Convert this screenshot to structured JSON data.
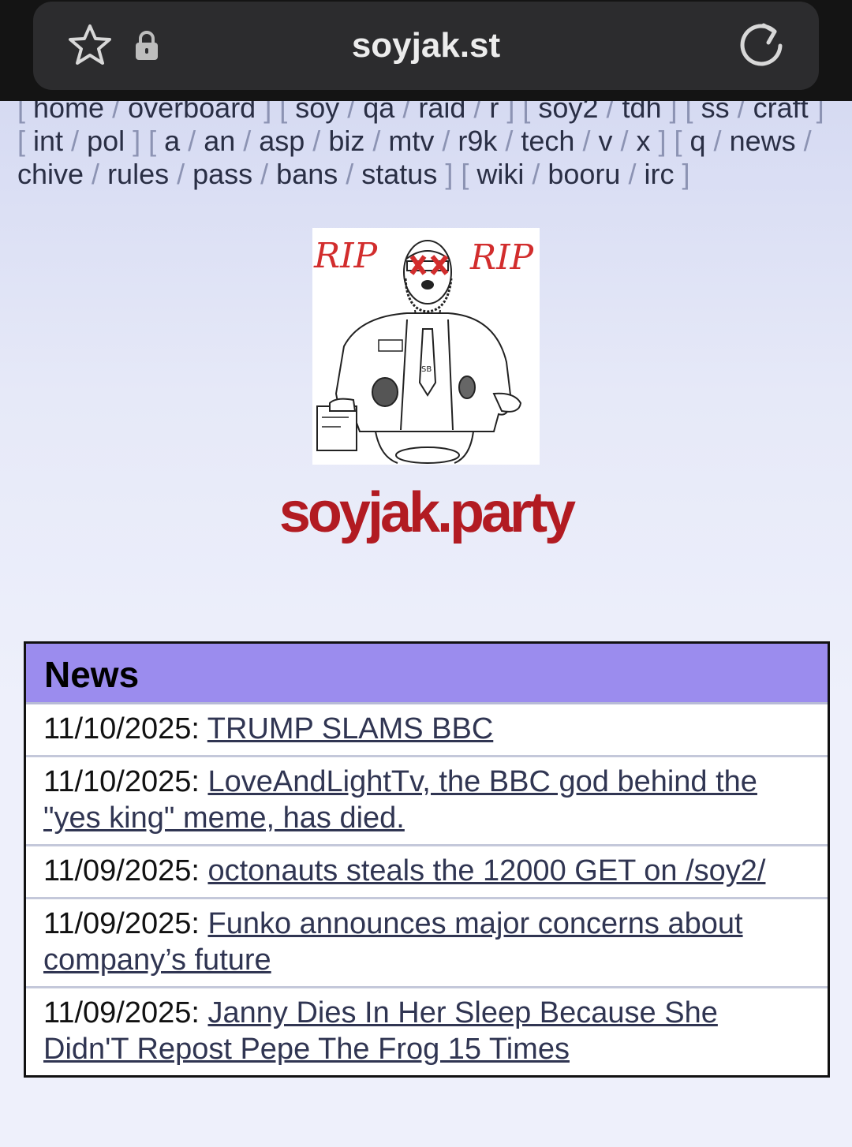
{
  "browser": {
    "url": "soyjak.st",
    "icons": [
      "star-icon",
      "lock-icon",
      "reload-icon"
    ]
  },
  "boardlist": {
    "groups": [
      [
        "home",
        "overboard"
      ],
      [
        "soy",
        "qa",
        "raid",
        "r"
      ],
      [
        "soy2",
        "tdh"
      ],
      [
        "ss",
        "craft"
      ],
      [
        "int",
        "pol"
      ],
      [
        "a",
        "an",
        "asp",
        "biz",
        "mtv",
        "r9k",
        "tech",
        "v",
        "x"
      ],
      [
        "q",
        "news",
        "chive",
        "rules",
        "pass",
        "bans",
        "status"
      ],
      [
        "wiki",
        "booru",
        "irc"
      ]
    ]
  },
  "logo": {
    "rip_left": "RIP",
    "rip_right": "RIP",
    "badge_text": "SB"
  },
  "site": {
    "title": "soyjak.party",
    "colors": {
      "title": "#b21b22",
      "news_header": "#9b8cee"
    }
  },
  "news": {
    "heading": "News",
    "items": [
      {
        "date": "11/10/2025: ",
        "title": "TRUMP SLAMS BBC"
      },
      {
        "date": "11/10/2025: ",
        "title": "LoveAndLightTv, the BBC god behind the \"yes king\" meme, has died."
      },
      {
        "date": "11/09/2025: ",
        "title": "octonauts steals the 12000 GET on /soy2/"
      },
      {
        "date": "11/09/2025: ",
        "title": "Funko announces major concerns about company’s future"
      },
      {
        "date": "11/09/2025: ",
        "title": "Janny Dies In Her Sleep Because She Didn'T Repost Pepe The Frog 15 Times"
      }
    ]
  }
}
